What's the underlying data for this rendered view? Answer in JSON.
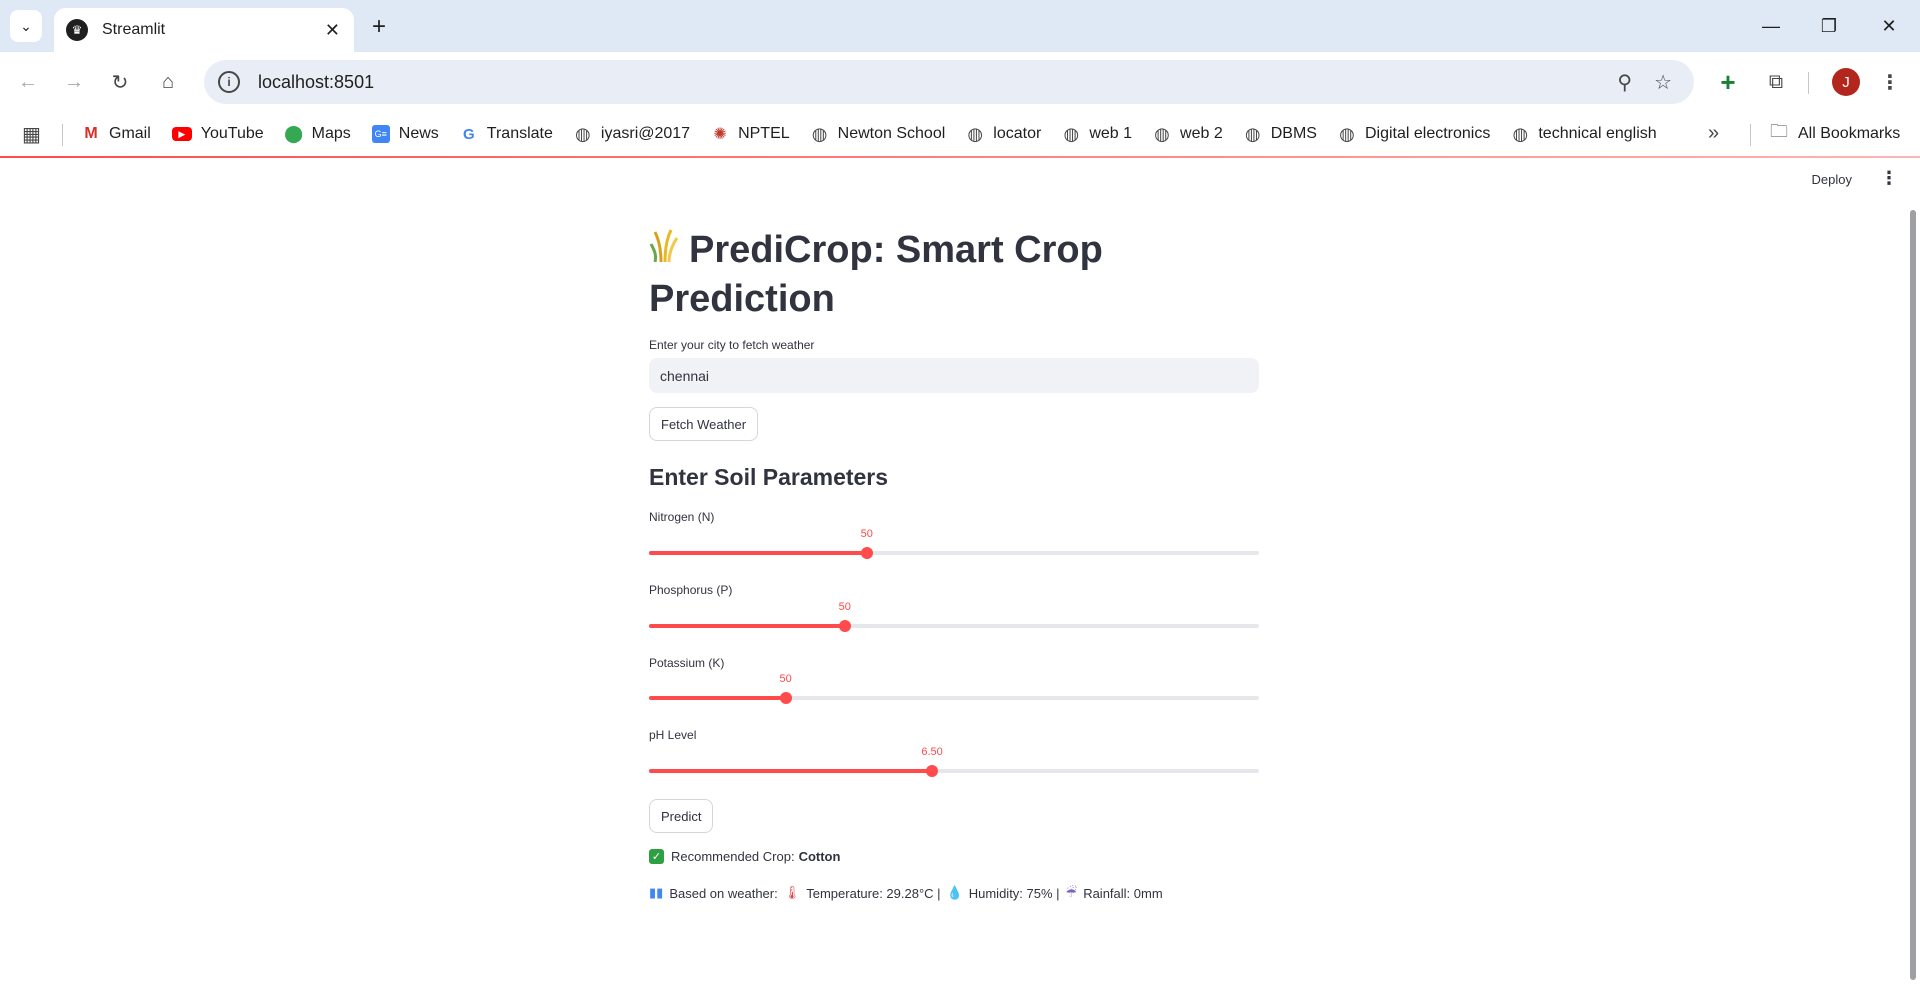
{
  "browser": {
    "tab_title": "Streamlit",
    "url": "localhost:8501",
    "profile_initial": "J",
    "bookmarks": [
      {
        "label": "Gmail",
        "icon": "gmail-icon"
      },
      {
        "label": "YouTube",
        "icon": "youtube-icon"
      },
      {
        "label": "Maps",
        "icon": "maps-icon"
      },
      {
        "label": "News",
        "icon": "news-icon"
      },
      {
        "label": "Translate",
        "icon": "translate-icon"
      },
      {
        "label": "iyasri@2017",
        "icon": "globe-icon"
      },
      {
        "label": "NPTEL",
        "icon": "nptel-icon"
      },
      {
        "label": "Newton School",
        "icon": "globe-icon"
      },
      {
        "label": "locator",
        "icon": "globe-icon"
      },
      {
        "label": "web 1",
        "icon": "globe-icon"
      },
      {
        "label": "web 2",
        "icon": "globe-icon"
      },
      {
        "label": "DBMS",
        "icon": "globe-icon"
      },
      {
        "label": "Digital electronics",
        "icon": "globe-icon"
      },
      {
        "label": "technical english",
        "icon": "globe-icon"
      }
    ],
    "all_bookmarks": "All Bookmarks"
  },
  "app": {
    "deploy_label": "Deploy",
    "title": "PrediCrop: Smart Crop Prediction",
    "city_label": "Enter your city to fetch weather",
    "city_value": "chennai",
    "fetch_button": "Fetch Weather",
    "soil_header": "Enter Soil Parameters",
    "sliders": {
      "nitrogen": {
        "label": "Nitrogen (N)",
        "value": "50",
        "fraction": 0.357
      },
      "phosphorus": {
        "label": "Phosphorus (P)",
        "value": "50",
        "fraction": 0.321
      },
      "potassium": {
        "label": "Potassium (K)",
        "value": "50",
        "fraction": 0.224
      },
      "ph": {
        "label": "pH Level",
        "value": "6.50",
        "fraction": 0.464
      }
    },
    "predict_button": "Predict",
    "result": {
      "prefix": "Recommended Crop:",
      "crop": "Cotton"
    },
    "weather": {
      "prefix": "Based on weather:",
      "temperature": "Temperature: 29.28°C |",
      "humidity": "Humidity: 75% |",
      "rainfall": "Rainfall: 0mm"
    },
    "colors": {
      "accent": "#ff4b4b",
      "input_bg": "#f0f2f6"
    }
  }
}
